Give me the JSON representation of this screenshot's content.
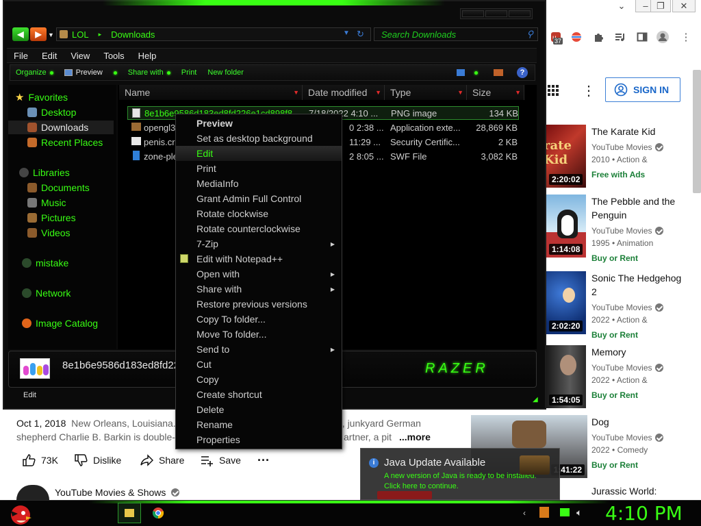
{
  "chrome": {
    "window_controls": [
      "chevron-down",
      "minimize",
      "restore",
      "close"
    ],
    "extension_badge": "37",
    "sign_in_label": "SIGN IN",
    "colors": {
      "accent": "#1a67c9"
    }
  },
  "recommendations": [
    {
      "title": "The Karate Kid",
      "channel": "YouTube Movies",
      "meta": "2010 • Action &",
      "tag": "Free with Ads",
      "duration": "2:20:02"
    },
    {
      "title": "The Pebble and the Penguin",
      "channel": "YouTube Movies",
      "meta": "1995 • Animation",
      "tag": "Buy or Rent",
      "duration": "1:14:08"
    },
    {
      "title": "Sonic The Hedgehog 2",
      "channel": "YouTube Movies",
      "meta": "2022 • Action &",
      "tag": "Buy or Rent",
      "duration": "2:02:20"
    },
    {
      "title": "Memory",
      "channel": "YouTube Movies",
      "meta": "2022 • Action &",
      "tag": "Buy or Rent",
      "duration": "1:54:05"
    },
    {
      "title": "Dog",
      "channel": "YouTube Movies",
      "meta": "2022 • Comedy",
      "tag": "Buy or Rent",
      "duration": "1:41:22"
    },
    {
      "title": "Jurassic World:"
    }
  ],
  "video": {
    "date": "Oct 1, 2018",
    "desc_line1": "New Orleans, Louisiana...",
    "desc_line1_tail": "d, junkyard German",
    "desc_line2": "shepherd Charlie B. Barkin is double-c",
    "desc_line2_tail": "artner, a pit",
    "more": "...more",
    "likes": "73K",
    "dislike": "Dislike",
    "share": "Share",
    "save": "Save",
    "channel": "YouTube Movies & Shows"
  },
  "explorer": {
    "address": [
      "LOL",
      "Downloads"
    ],
    "search_placeholder": "Search Downloads",
    "menu": [
      "File",
      "Edit",
      "View",
      "Tools",
      "Help"
    ],
    "commands": [
      "Organize",
      "Preview",
      "Share with",
      "Print",
      "New folder"
    ],
    "nav": {
      "favorites": "Favorites",
      "desktop": "Desktop",
      "downloads": "Downloads",
      "recent": "Recent Places",
      "libraries": "Libraries",
      "documents": "Documents",
      "music": "Music",
      "pictures": "Pictures",
      "videos": "Videos",
      "mistake": "mistake",
      "network": "Network",
      "image_catalog": "Image Catalog"
    },
    "columns": [
      "Name",
      "Date modified",
      "Type",
      "Size"
    ],
    "files": [
      {
        "name": "8e1b6e9586d183ed8fd226e1cd898f8",
        "date": "7/18/2022 4:10 ...",
        "type": "PNG image",
        "size": "134 KB"
      },
      {
        "name": "opengl3",
        "date": "0 2:38 ...",
        "type": "Application exte...",
        "size": "28,869 KB"
      },
      {
        "name": "penis.cr",
        "date": "11:29 ...",
        "type": "Security Certific...",
        "size": "2 KB"
      },
      {
        "name": "zone-ple",
        "date": "2 8:05 ...",
        "type": "SWF File",
        "size": "3,082 KB"
      }
    ],
    "details_name": "8e1b6e9586d183ed8fd22",
    "status": "Edit",
    "brand": "RAZER",
    "colors": {
      "accent": "#39ff14",
      "background": "#0b0b0b"
    }
  },
  "context_menu": {
    "items": [
      {
        "label": "Preview",
        "bold": true
      },
      {
        "label": "Set as desktop background"
      },
      {
        "label": "Edit",
        "highlighted": true
      },
      {
        "label": "Print"
      },
      {
        "label": "MediaInfo"
      },
      {
        "label": "Grant Admin Full Control"
      },
      {
        "label": "Rotate clockwise"
      },
      {
        "label": "Rotate counterclockwise"
      },
      {
        "label": "7-Zip",
        "submenu": true
      },
      {
        "label": "Edit with Notepad++",
        "icon": "notepad-plus-icon"
      },
      {
        "label": "Open with",
        "submenu": true
      },
      {
        "label": "Share with",
        "submenu": true
      },
      {
        "label": "Restore previous versions"
      },
      {
        "label": "Copy To folder..."
      },
      {
        "label": "Move To folder..."
      },
      {
        "label": "Send to",
        "submenu": true
      },
      {
        "label": "Cut"
      },
      {
        "label": "Copy"
      },
      {
        "label": "Create shortcut"
      },
      {
        "label": "Delete"
      },
      {
        "label": "Rename"
      },
      {
        "label": "Properties"
      }
    ]
  },
  "java": {
    "title": "Java Update Available",
    "line1": "A new version of Java is ready to be installed.",
    "line2": "Click here to continue."
  },
  "taskbar": {
    "clock": "4:10 PM"
  }
}
